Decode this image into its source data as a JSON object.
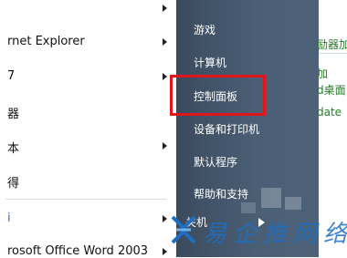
{
  "left_menu": {
    "items": [
      {
        "label": "",
        "has_arrow": true
      },
      {
        "label": "rnet Explorer",
        "has_arrow": true
      },
      {
        "label": "7",
        "has_arrow": true
      },
      {
        "label": "器",
        "has_arrow": false
      },
      {
        "label": "本",
        "has_arrow": true
      },
      {
        "label": "得",
        "has_arrow": false
      },
      {
        "label": "i",
        "has_arrow": true
      },
      {
        "label": "rosoft Office Word 2003",
        "has_arrow": true
      }
    ]
  },
  "right_menu": {
    "items": [
      {
        "label": "游戏"
      },
      {
        "label": "计算机"
      },
      {
        "label": "控制面板"
      },
      {
        "label": "设备和打印机"
      },
      {
        "label": "默认程序"
      },
      {
        "label": "帮助和支持"
      }
    ],
    "shutdown_label": "关机",
    "highlighted_item": "控制面板"
  },
  "background": {
    "fragments": [
      "励器加",
      "加",
      "d桌面",
      "date"
    ]
  },
  "watermark": {
    "text": "易企推网络"
  },
  "colors": {
    "highlight": "#e0161b",
    "pane_dark": "#4a5e74",
    "watermark": "#1d6fc4"
  }
}
